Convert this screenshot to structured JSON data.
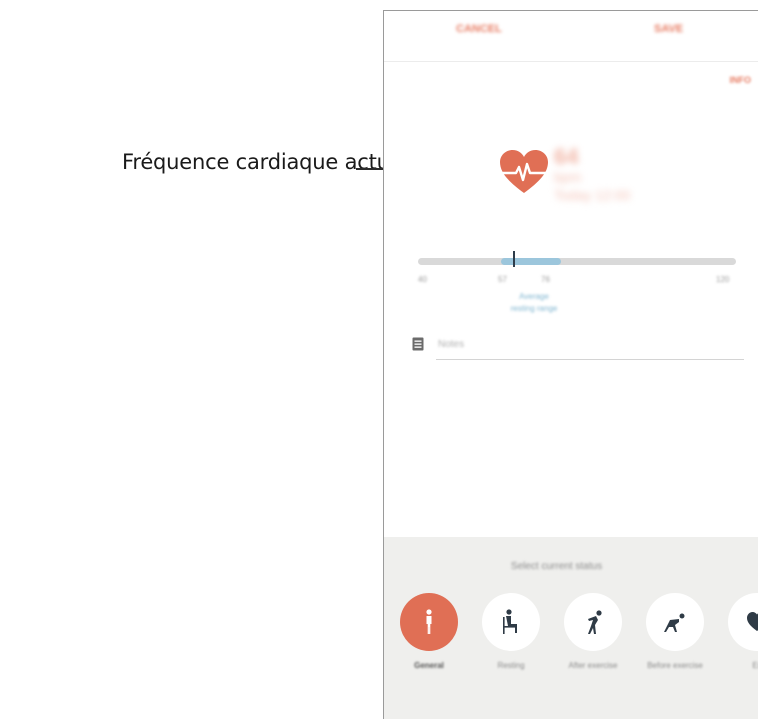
{
  "callout": {
    "label": "Fréquence cardiaque actuelle"
  },
  "header": {
    "cancel_label": "CANCEL",
    "save_label": "SAVE"
  },
  "info_label": "INFO",
  "reading": {
    "value": "64",
    "unit": "bpm",
    "time": "Today 12:00"
  },
  "gauge": {
    "min_label": "40",
    "low_label": "57",
    "high_label": "76",
    "max_label": "120",
    "avg_line1": "Average",
    "avg_line2": "resting range",
    "range_start_fraction": 0.26,
    "range_end_fraction": 0.45,
    "current_fraction": 0.3
  },
  "memo": {
    "placeholder": "Notes"
  },
  "status_panel": {
    "title": "Select current status",
    "items": [
      {
        "label": "General",
        "icon": "standing-person-icon",
        "selected": true
      },
      {
        "label": "Resting",
        "icon": "sitting-person-icon",
        "selected": false
      },
      {
        "label": "After exercise",
        "icon": "bent-over-person-icon",
        "selected": false
      },
      {
        "label": "Before exercise",
        "icon": "stretching-person-icon",
        "selected": false
      },
      {
        "label": "Ex",
        "icon": "heart-partial-icon",
        "selected": false
      }
    ]
  },
  "colors": {
    "accent": "#e06f55",
    "range": "#9cc6dc",
    "panel": "#efefed"
  }
}
